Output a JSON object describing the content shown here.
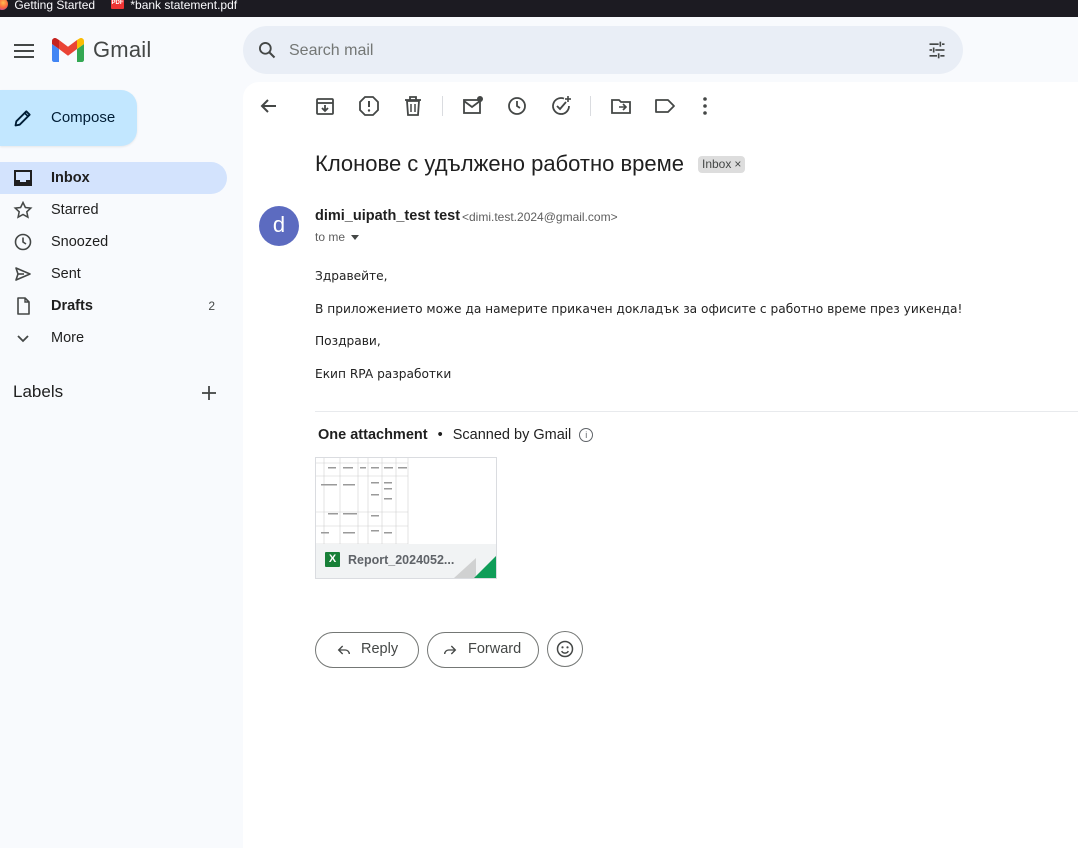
{
  "bookmarks": [
    {
      "label": "Getting Started"
    },
    {
      "label": "*bank statement.pdf",
      "icon_text": "PDF"
    }
  ],
  "header": {
    "app_name": "Gmail",
    "search_placeholder": "Search mail"
  },
  "compose_label": "Compose",
  "nav": [
    {
      "label": "Inbox",
      "count": "",
      "active": true
    },
    {
      "label": "Starred",
      "count": ""
    },
    {
      "label": "Snoozed",
      "count": ""
    },
    {
      "label": "Sent",
      "count": ""
    },
    {
      "label": "Drafts",
      "count": "2"
    },
    {
      "label": "More",
      "count": ""
    }
  ],
  "labels_title": "Labels",
  "email": {
    "subject": "Клонове с удължено работно време",
    "tag": "Inbox",
    "tag_close": "×",
    "avatar_letter": "d",
    "sender_name": "dimi_uipath_test test",
    "sender_email": "<dimi.test.2024@gmail.com>",
    "to": "to me",
    "body": [
      "Здравейте,",
      "В приложението може да намерите прикачен докладък за офисите с работно време през уикенда!",
      "Поздрави,",
      "Екип RPA разработки"
    ]
  },
  "attachments": {
    "title": "One attachment",
    "separator": "•",
    "scanned": "Scanned by Gmail",
    "info_glyph": "i",
    "file_name": "Report_2024052...",
    "file_icon": "X"
  },
  "actions": {
    "reply": "Reply",
    "forward": "Forward"
  },
  "colors": {
    "accent": "#c2e7ff",
    "active_nav": "#d3e3fd",
    "avatar": "#5c6bc0",
    "excel_green": "#188038"
  }
}
